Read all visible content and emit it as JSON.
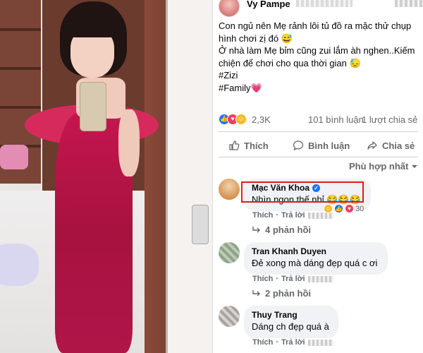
{
  "post": {
    "author_name": "Vy Pampe",
    "text_lines": [
      "Con ngủ nên Mẹ rảnh lôi tủ đồ ra mặc thử chụp hình chơi zị đó 😅",
      "Ở nhà làm Mẹ bỉm cũng zui lắm àh nghen..Kiếm chiện để chơi cho qua thời gian 😓"
    ],
    "hashtags": [
      "#Zizi",
      "#Family💗"
    ],
    "reaction_count": "2,3K",
    "comment_count": "101 bình luận",
    "share_count": "1 lượt chia sẻ"
  },
  "actions": {
    "like": "Thích",
    "comment": "Bình luận",
    "share": "Chia sẻ"
  },
  "sort_label": "Phù hợp nhất",
  "comments": [
    {
      "name": "Mạc Văn Khoa",
      "text": "Nhìn ngon thế nhỉ 😂😂😂",
      "like": "Thích",
      "reply": "Trả lời",
      "reaction_count": "30",
      "replies": "4 phản hồi",
      "verified": true
    },
    {
      "name": "Tran Khanh Duyen",
      "text": "Đẻ xong mà dáng đẹp quá c ơi",
      "like": "Thích",
      "reply": "Trả lời",
      "replies": "2 phản hồi"
    },
    {
      "name": "Thuy Trang",
      "text": "Dáng ch đẹp quá à",
      "like": "Thích",
      "reply": "Trả lời"
    }
  ],
  "colors": {
    "fb_blue": "#1877f2",
    "highlight_red": "#e21b1b",
    "dress": "#c4164f"
  }
}
